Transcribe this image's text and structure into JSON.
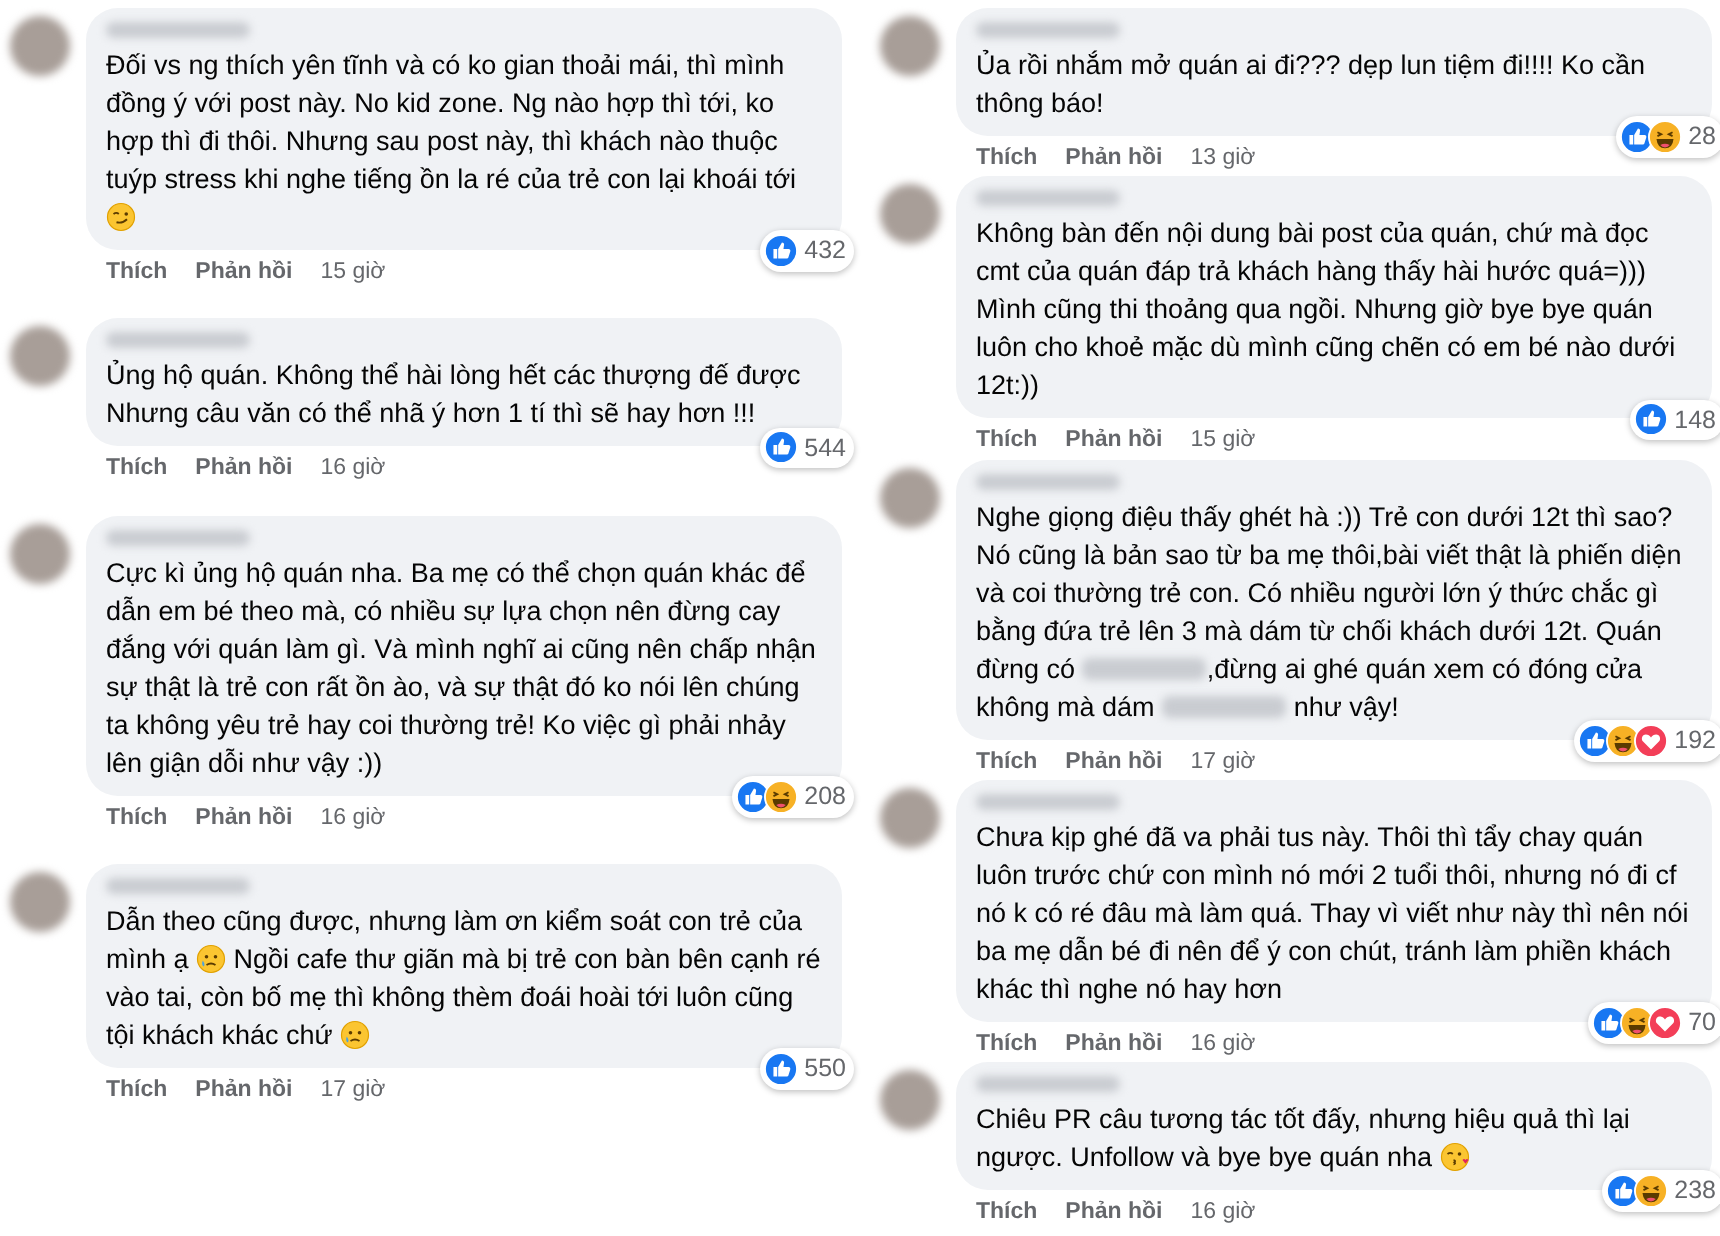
{
  "columns": [
    {
      "comments": [
        {
          "segments": [
            {
              "kind": "text",
              "text": "Đối vs ng thích yên tĩnh và có ko gian thoải mái, thì mình đồng ý với post này. No kid zone. Ng nào hợp thì tới, ko hợp thì đi thôi. Nhưng sau post này, thì khách nào thuộc tuýp stress khi nghe tiếng ồn la ré của trẻ con lại khoái tới "
            },
            {
              "kind": "smirk"
            }
          ],
          "reactions": [
            {
              "kind": "like"
            }
          ],
          "reaction_count": "432",
          "actions": [
            "Thích",
            "Phản hồi"
          ],
          "time": "15 giờ"
        },
        {
          "segments": [
            {
              "kind": "text",
              "text": "Ủng hộ quán. Không thể hài lòng hết các thượng đế được\nNhưng câu văn có thể nhã ý hơn 1 tí thì sẽ hay hơn !!!"
            }
          ],
          "reactions": [
            {
              "kind": "like"
            }
          ],
          "reaction_count": "544",
          "actions": [
            "Thích",
            "Phản hồi"
          ],
          "time": "16 giờ"
        },
        {
          "segments": [
            {
              "kind": "text",
              "text": "Cực kì ủng hộ quán nha. Ba mẹ có thể chọn quán khác để dẫn em bé theo mà, có nhiều sự lựa chọn nên đừng cay đắng với quán làm gì. Và mình nghĩ ai cũng nên chấp nhận sự thật là trẻ con rất ồn ào, và sự thật đó ko nói lên chúng ta không yêu trẻ hay coi thường trẻ! Ko việc gì phải nhảy lên giận dỗi như vậy :))"
            }
          ],
          "reactions": [
            {
              "kind": "like"
            },
            {
              "kind": "haha"
            }
          ],
          "reaction_count": "208",
          "actions": [
            "Thích",
            "Phản hồi"
          ],
          "time": "16 giờ"
        },
        {
          "segments": [
            {
              "kind": "text",
              "text": "Dẫn theo cũng được, nhưng làm ơn kiểm soát con trẻ của mình ạ "
            },
            {
              "kind": "teary"
            },
            {
              "kind": "text",
              "text": " Ngồi cafe thư giãn mà bị trẻ con bàn bên cạnh ré vào tai, còn bố mẹ thì không thèm đoái hoài tới luôn cũng tội khách khác chứ "
            },
            {
              "kind": "teary"
            }
          ],
          "reactions": [
            {
              "kind": "like"
            }
          ],
          "reaction_count": "550",
          "actions": [
            "Thích",
            "Phản hồi"
          ],
          "time": "17 giờ"
        }
      ]
    },
    {
      "comments": [
        {
          "segments": [
            {
              "kind": "text",
              "text": "Ủa rồi nhắm mở quán ai đi??? dẹp lun tiệm đi!!!! Ko cần thông báo!"
            }
          ],
          "reactions": [
            {
              "kind": "like"
            },
            {
              "kind": "haha"
            }
          ],
          "reaction_count": "28",
          "actions": [
            "Thích",
            "Phản hồi"
          ],
          "time": "13 giờ"
        },
        {
          "segments": [
            {
              "kind": "text",
              "text": "Không bàn đến nội dung bài post của quán, chứ mà đọc cmt của quán đáp trả khách hàng thấy hài hước quá=))) Mình cũng thi thoảng qua ngồi. Nhưng giờ bye bye quán luôn cho khoẻ mặc dù mình cũng chẽn có em bé nào dưới 12t:))"
            }
          ],
          "reactions": [
            {
              "kind": "like"
            }
          ],
          "reaction_count": "148",
          "actions": [
            "Thích",
            "Phản hồi"
          ],
          "time": "15 giờ"
        },
        {
          "segments": [
            {
              "kind": "text",
              "text": "Nghe giọng điệu thấy ghét hà :)) Trẻ con dưới 12t thì sao? Nó cũng là bản sao từ ba mẹ thôi,bài viết thật là phiến diện và coi thường trẻ con. Có nhiều người lớn ý thức chắc gì bằng đứa trẻ lên 3 mà dám từ chối khách dưới 12t. Quán đừng có "
            },
            {
              "kind": "redacted"
            },
            {
              "kind": "text",
              "text": ",đừng ai ghé quán xem có đóng cửa không mà dám "
            },
            {
              "kind": "redacted"
            },
            {
              "kind": "text",
              "text": " như vậy!"
            }
          ],
          "reactions": [
            {
              "kind": "like"
            },
            {
              "kind": "haha"
            },
            {
              "kind": "love"
            }
          ],
          "reaction_count": "192",
          "actions": [
            "Thích",
            "Phản hồi"
          ],
          "time": "17 giờ"
        },
        {
          "segments": [
            {
              "kind": "text",
              "text": "Chưa kịp ghé đã va phải tus này. Thôi thì tẩy chay quán luôn trước chứ con mình nó mới 2 tuổi thôi, nhưng nó đi cf nó k có ré đâu mà làm quá. Thay vì viết như này thì nên nói ba mẹ dẫn bé đi nên để ý con chút, tránh làm phiền khách khác thì nghe nó hay hơn"
            }
          ],
          "reactions": [
            {
              "kind": "like"
            },
            {
              "kind": "haha"
            },
            {
              "kind": "love"
            }
          ],
          "reaction_count": "70",
          "actions": [
            "Thích",
            "Phản hồi"
          ],
          "time": "16 giờ"
        },
        {
          "segments": [
            {
              "kind": "text",
              "text": "Chiêu PR câu tương tác tốt đấy, nhưng hiệu quả thì lại ngược. Unfollow và bye bye quán nha "
            },
            {
              "kind": "kiss"
            }
          ],
          "reactions": [
            {
              "kind": "like"
            },
            {
              "kind": "haha"
            }
          ],
          "reaction_count": "238",
          "actions": [
            "Thích",
            "Phản hồi"
          ],
          "time": "16 giờ"
        }
      ]
    }
  ]
}
